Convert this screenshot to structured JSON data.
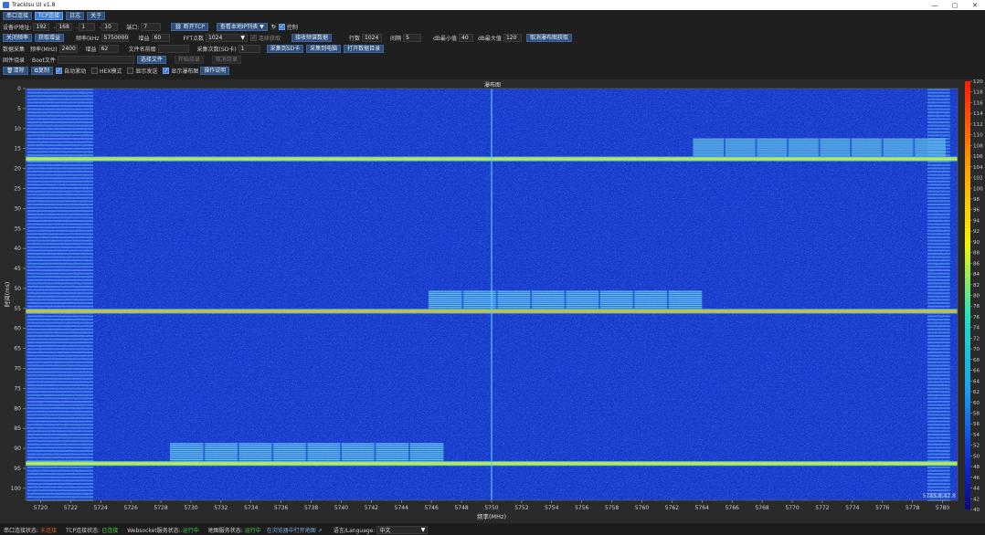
{
  "window": {
    "title": "TrackIsu UI v1.8",
    "min": "—",
    "max": "▢",
    "close": "✕"
  },
  "tabs": [
    "串口连接",
    "TCP连接",
    "日志",
    "关于"
  ],
  "row1": {
    "ip_label": "设备IP地址:",
    "ip": [
      "192",
      "168",
      "1",
      "10"
    ],
    "port_label": "端口:",
    "port": "7",
    "disconnect": "断开TCP",
    "list_btn": "查看本地IP列表",
    "control_label": "控制"
  },
  "row2": {
    "stop_btn": "关闭频率",
    "get_btn": "获取增益",
    "freq_label": "频率(kHz",
    "freq": "5750000",
    "gain_label": "增益",
    "gain": "60",
    "fft_label": "FFT点数",
    "fft": "1024",
    "continuous_label": "连续获取",
    "recv_btn": "接收频谱数据",
    "rows_label": "行数",
    "rows": "1024",
    "interval_label": "间隔",
    "interval": "5",
    "dbmin_label": "dB最小值",
    "dbmin": "40",
    "dbmax_label": "dB最大值",
    "dbmax": "120",
    "cancel_btn": "取消瀑布图获取"
  },
  "row3": {
    "acq_label": "数据采集",
    "freq_label": "频率(MHz)",
    "freq": "2400",
    "gain_label": "增益",
    "gain": "62",
    "file_label": "文件名前缀",
    "file": "",
    "count_label": "采集次数(SD卡)",
    "count": "1",
    "sd_btn": "采集到SD卡",
    "pc_btn": "采集到电脑",
    "open_btn": "打开数据目录"
  },
  "row4": {
    "fw_label": "固件烧录",
    "boot_label": "Boot文件",
    "boot": "",
    "choose_btn": "选择文件",
    "burn_btn": "开始烧录",
    "cancel_btn": "取消烧录"
  },
  "row5": {
    "clear_btn": "清除",
    "copy_btn": "复制",
    "autoscroll": "自动滚动",
    "hex": "HEX模式",
    "showtx": "显示发送",
    "showwf": "显示瀑布图",
    "help_btn": "操作说明"
  },
  "chart_data": {
    "type": "heatmap",
    "title": "瀑布图",
    "xlabel": "频率(MHz)",
    "ylabel": "时间(ms)",
    "x_ticks": [
      "5720",
      "5722",
      "5724",
      "5726",
      "5728",
      "5730",
      "5732",
      "5734",
      "5736",
      "5738",
      "5740",
      "5742",
      "5744",
      "5746",
      "5748",
      "5750",
      "5752",
      "5754",
      "5756",
      "5758",
      "5760",
      "5762",
      "5764",
      "5766",
      "5768",
      "5770",
      "5772",
      "5774",
      "5776",
      "5778",
      "5780"
    ],
    "x_range": [
      5719,
      5781
    ],
    "y_ticks": [
      "0",
      "5",
      "10",
      "15",
      "20",
      "25",
      "30",
      "35",
      "40",
      "45",
      "50",
      "55",
      "60",
      "65",
      "70",
      "75",
      "80",
      "85",
      "90",
      "95",
      "100"
    ],
    "y_range": [
      0,
      103
    ],
    "colorbar_ticks": [
      "120",
      "118",
      "116",
      "114",
      "112",
      "110",
      "108",
      "106",
      "104",
      "102",
      "100",
      "98",
      "96",
      "94",
      "92",
      "90",
      "88",
      "86",
      "84",
      "82",
      "80",
      "78",
      "76",
      "74",
      "72",
      "70",
      "68",
      "66",
      "64",
      "62",
      "60",
      "58",
      "56",
      "54",
      "52",
      "50",
      "48",
      "46",
      "44",
      "42",
      "40"
    ],
    "colorbar_range": [
      40,
      120
    ],
    "background_level": 62,
    "horizontal_lines_ms": [
      17.6,
      55.7,
      93.8
    ],
    "center_line_mhz": 5750,
    "bursts": [
      {
        "ms_start": 12.5,
        "ms_end": 17.2,
        "mhz_start": 5763.4,
        "mhz_end": 5780.2
      },
      {
        "ms_start": 50.6,
        "ms_end": 55.3,
        "mhz_start": 5745.8,
        "mhz_end": 5764.0
      },
      {
        "ms_start": 88.7,
        "ms_end": 93.4,
        "mhz_start": 5728.6,
        "mhz_end": 5746.8
      }
    ],
    "edge_band_left_mhz": [
      5719.1,
      5723.5
    ],
    "edge_band_right_mhz": [
      5779.0,
      5780.5
    ],
    "cursor_readout": "5745.8:47.8"
  },
  "status": {
    "serial_label": "串口连接状态:",
    "serial": "未连接",
    "tcp_label": "TCP连接状态:",
    "tcp": "已连接",
    "ws_label": "Websocket服务状态:",
    "ws": "运行中",
    "map_label": "地图服务状态:",
    "map": "运行中",
    "map_link": "在浏览器中打开地图",
    "lang_label": "语言/Language:",
    "lang": "中文"
  }
}
